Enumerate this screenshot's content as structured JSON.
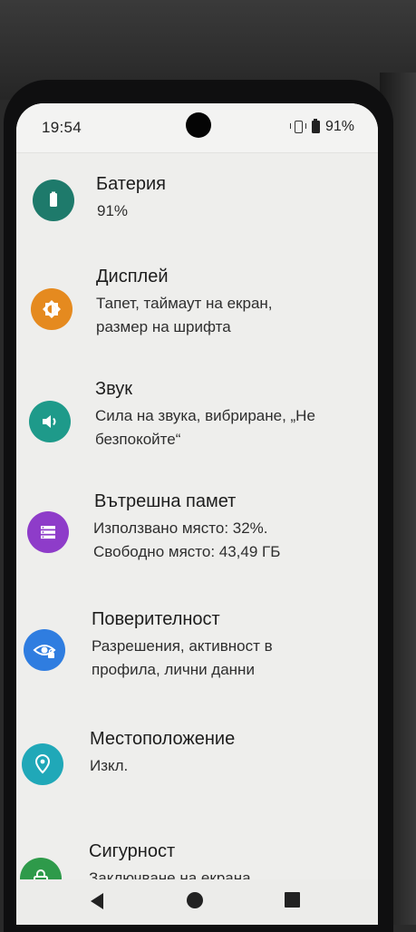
{
  "status_bar": {
    "time": "19:54",
    "battery_percent": "91%",
    "icons": [
      "vibrate-icon",
      "battery-icon"
    ]
  },
  "settings": [
    {
      "title": "Батерия",
      "subtitle": [
        "91%"
      ],
      "icon": "battery-icon",
      "color": "#1e7a6b"
    },
    {
      "title": "Дисплей",
      "subtitle": [
        "Тапет, таймаут на екран,",
        "размер на шрифта"
      ],
      "icon": "brightness-icon",
      "color": "#e58a1f"
    },
    {
      "title": "Звук",
      "subtitle": [
        "Сила на звука, вибриране, „Не",
        "безпокойте“"
      ],
      "icon": "volume-icon",
      "color": "#1e9a8a"
    },
    {
      "title": "Вътрешна памет",
      "subtitle": [
        "Използвано място: 32%.",
        "Свободно място: 43,49 ГБ"
      ],
      "icon": "storage-icon",
      "color": "#8e3cc9"
    },
    {
      "title": "Поверителност",
      "subtitle": [
        "Разрешения, активност в",
        "профила, лични данни"
      ],
      "icon": "privacy-eye-icon",
      "color": "#2f7de0"
    },
    {
      "title": "Местоположение",
      "subtitle": [
        "Изкл."
      ],
      "icon": "location-pin-icon",
      "color": "#20a8b8"
    },
    {
      "title": "Сигурност",
      "subtitle": [
        "Заключване на екрана,"
      ],
      "icon": "lock-icon",
      "color": "#2e9a4a"
    }
  ],
  "nav_bar": {
    "buttons": [
      "back-icon",
      "home-icon",
      "recents-icon"
    ]
  }
}
